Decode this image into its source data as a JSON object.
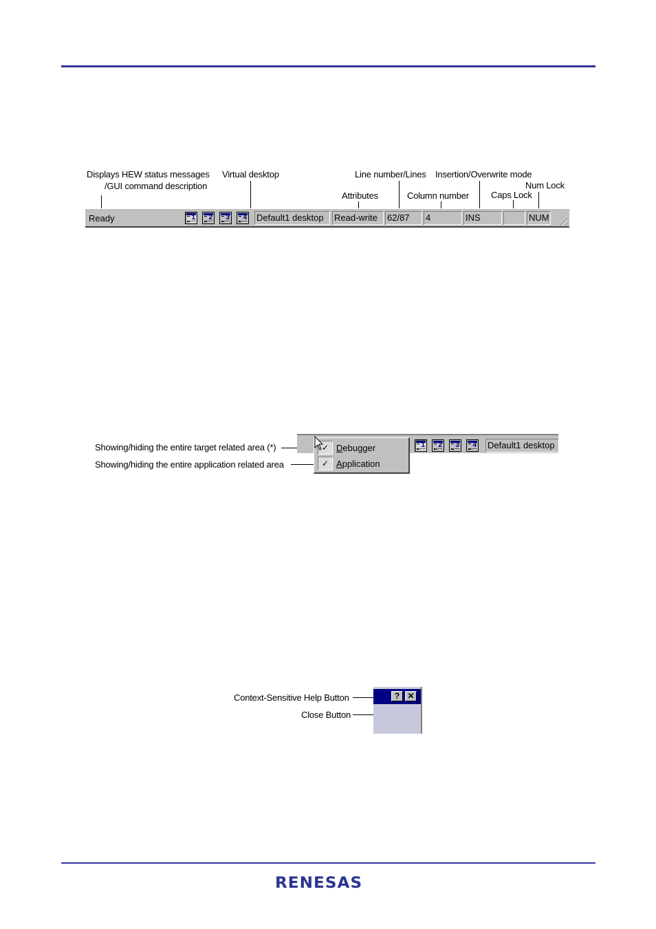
{
  "figure1": {
    "callouts": {
      "status_line1": "Displays HEW status messages",
      "status_line2": "/GUI command description",
      "virtual_desktop": "Virtual desktop",
      "line_number": "Line number/Lines",
      "insert_mode": "Insertion/Overwrite mode",
      "attributes": "Attributes",
      "column_number": "Column number",
      "caps_lock": "Caps Lock",
      "num_lock": "Num Lock"
    },
    "statusbar": {
      "message": "Ready",
      "desktop_buttons": [
        "1",
        "2",
        "3",
        "4"
      ],
      "active_desktop": 1,
      "desktop_name": "Default1 desktop",
      "attributes": "Read-write",
      "line": "62/87",
      "column": "4",
      "mode": "INS",
      "caps": "",
      "num": "NUM"
    }
  },
  "figure2": {
    "callouts": {
      "target": "Showing/hiding the entire target related area (*)",
      "application": "Showing/hiding the entire application related area"
    },
    "menu": [
      {
        "label": "Debugger",
        "mnemonic": "D",
        "checked": true
      },
      {
        "label": "Application",
        "mnemonic": "A",
        "checked": true
      }
    ],
    "check_glyph": "✓",
    "desktop_buttons": [
      "1",
      "2",
      "3",
      "4"
    ],
    "desktop_name": "Default1 desktop"
  },
  "figure3": {
    "callouts": {
      "help": "Context-Sensitive Help Button",
      "close": "Close Button"
    },
    "help_glyph": "?",
    "close_glyph": "✕"
  },
  "footer": {
    "logo": "RENESAS"
  },
  "colors": {
    "rule": "#333399",
    "logo": "#2a3590",
    "titlebar": "#000080"
  }
}
